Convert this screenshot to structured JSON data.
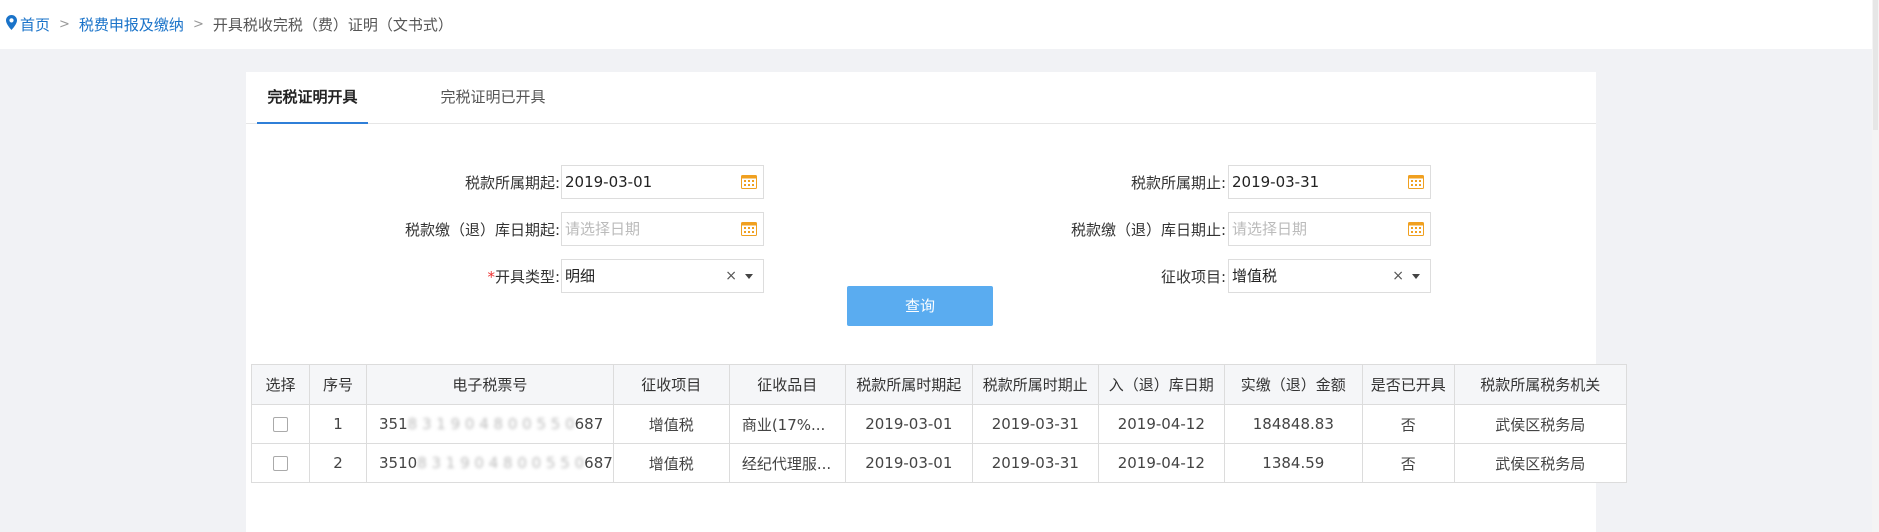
{
  "breadcrumb": {
    "home": "首页",
    "level2": "税费申报及缴纳",
    "current": "开具税收完税（费）证明（文书式）",
    "separator": ">"
  },
  "tabs": [
    {
      "label": "完税证明开具",
      "active": true
    },
    {
      "label": "完税证明已开具",
      "active": false
    }
  ],
  "form": {
    "period_start_label": "税款所属期起:",
    "period_start_value": "2019-03-01",
    "period_end_label": "税款所属期止:",
    "period_end_value": "2019-03-31",
    "storage_start_label": "税款缴（退）库日期起:",
    "storage_start_placeholder": "请选择日期",
    "storage_end_label": "税款缴（退）库日期止:",
    "storage_end_placeholder": "请选择日期",
    "issue_type_required_mark": "*",
    "issue_type_label": "开具类型:",
    "issue_type_value": "明细",
    "levy_item_label": "征收项目:",
    "levy_item_value": "增值税",
    "clear_symbol": "×",
    "query_button": "查询"
  },
  "table": {
    "headers": [
      "选择",
      "序号",
      "电子税票号",
      "征收项目",
      "征收品目",
      "税款所属时期起",
      "税款所属时期止",
      "入（退）库日期",
      "实缴（退）金额",
      "是否已开具",
      "税款所属税务机关"
    ],
    "rows": [
      {
        "seq": "1",
        "ticket_prefix": "351",
        "ticket_hidden": "8 3 1 9 0 4 8 0 0 5 5 0",
        "ticket_suffix": "687",
        "levy_item": "增值税",
        "levy_category": "商业(17%...",
        "period_start": "2019-03-01",
        "period_end": "2019-03-31",
        "storage_date": "2019-04-12",
        "amount": "184848.83",
        "issued": "否",
        "authority": "武侯区税务局"
      },
      {
        "seq": "2",
        "ticket_prefix": "3510",
        "ticket_hidden": "8 3 1 9 0 4 8 0 0 5 5 0",
        "ticket_suffix": "687",
        "levy_item": "增值税",
        "levy_category": "经纪代理服...",
        "period_start": "2019-03-01",
        "period_end": "2019-03-31",
        "storage_date": "2019-04-12",
        "amount": "1384.59",
        "issued": "否",
        "authority": "武侯区税务局"
      }
    ]
  },
  "colors": {
    "accent": "#2f7fd8",
    "button": "#5aacf0",
    "calendar_icon": "#f0a020"
  }
}
